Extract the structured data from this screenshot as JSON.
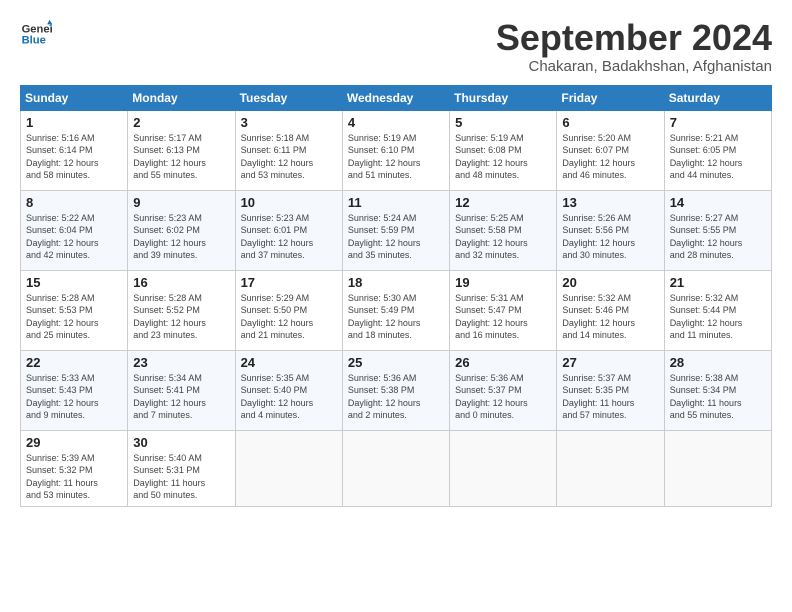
{
  "logo": {
    "line1": "General",
    "line2": "Blue"
  },
  "title": "September 2024",
  "subtitle": "Chakaran, Badakhshan, Afghanistan",
  "days_header": [
    "Sunday",
    "Monday",
    "Tuesday",
    "Wednesday",
    "Thursday",
    "Friday",
    "Saturday"
  ],
  "weeks": [
    [
      {
        "day": "1",
        "info": "Sunrise: 5:16 AM\nSunset: 6:14 PM\nDaylight: 12 hours\nand 58 minutes."
      },
      {
        "day": "2",
        "info": "Sunrise: 5:17 AM\nSunset: 6:13 PM\nDaylight: 12 hours\nand 55 minutes."
      },
      {
        "day": "3",
        "info": "Sunrise: 5:18 AM\nSunset: 6:11 PM\nDaylight: 12 hours\nand 53 minutes."
      },
      {
        "day": "4",
        "info": "Sunrise: 5:19 AM\nSunset: 6:10 PM\nDaylight: 12 hours\nand 51 minutes."
      },
      {
        "day": "5",
        "info": "Sunrise: 5:19 AM\nSunset: 6:08 PM\nDaylight: 12 hours\nand 48 minutes."
      },
      {
        "day": "6",
        "info": "Sunrise: 5:20 AM\nSunset: 6:07 PM\nDaylight: 12 hours\nand 46 minutes."
      },
      {
        "day": "7",
        "info": "Sunrise: 5:21 AM\nSunset: 6:05 PM\nDaylight: 12 hours\nand 44 minutes."
      }
    ],
    [
      {
        "day": "8",
        "info": "Sunrise: 5:22 AM\nSunset: 6:04 PM\nDaylight: 12 hours\nand 42 minutes."
      },
      {
        "day": "9",
        "info": "Sunrise: 5:23 AM\nSunset: 6:02 PM\nDaylight: 12 hours\nand 39 minutes."
      },
      {
        "day": "10",
        "info": "Sunrise: 5:23 AM\nSunset: 6:01 PM\nDaylight: 12 hours\nand 37 minutes."
      },
      {
        "day": "11",
        "info": "Sunrise: 5:24 AM\nSunset: 5:59 PM\nDaylight: 12 hours\nand 35 minutes."
      },
      {
        "day": "12",
        "info": "Sunrise: 5:25 AM\nSunset: 5:58 PM\nDaylight: 12 hours\nand 32 minutes."
      },
      {
        "day": "13",
        "info": "Sunrise: 5:26 AM\nSunset: 5:56 PM\nDaylight: 12 hours\nand 30 minutes."
      },
      {
        "day": "14",
        "info": "Sunrise: 5:27 AM\nSunset: 5:55 PM\nDaylight: 12 hours\nand 28 minutes."
      }
    ],
    [
      {
        "day": "15",
        "info": "Sunrise: 5:28 AM\nSunset: 5:53 PM\nDaylight: 12 hours\nand 25 minutes."
      },
      {
        "day": "16",
        "info": "Sunrise: 5:28 AM\nSunset: 5:52 PM\nDaylight: 12 hours\nand 23 minutes."
      },
      {
        "day": "17",
        "info": "Sunrise: 5:29 AM\nSunset: 5:50 PM\nDaylight: 12 hours\nand 21 minutes."
      },
      {
        "day": "18",
        "info": "Sunrise: 5:30 AM\nSunset: 5:49 PM\nDaylight: 12 hours\nand 18 minutes."
      },
      {
        "day": "19",
        "info": "Sunrise: 5:31 AM\nSunset: 5:47 PM\nDaylight: 12 hours\nand 16 minutes."
      },
      {
        "day": "20",
        "info": "Sunrise: 5:32 AM\nSunset: 5:46 PM\nDaylight: 12 hours\nand 14 minutes."
      },
      {
        "day": "21",
        "info": "Sunrise: 5:32 AM\nSunset: 5:44 PM\nDaylight: 12 hours\nand 11 minutes."
      }
    ],
    [
      {
        "day": "22",
        "info": "Sunrise: 5:33 AM\nSunset: 5:43 PM\nDaylight: 12 hours\nand 9 minutes."
      },
      {
        "day": "23",
        "info": "Sunrise: 5:34 AM\nSunset: 5:41 PM\nDaylight: 12 hours\nand 7 minutes."
      },
      {
        "day": "24",
        "info": "Sunrise: 5:35 AM\nSunset: 5:40 PM\nDaylight: 12 hours\nand 4 minutes."
      },
      {
        "day": "25",
        "info": "Sunrise: 5:36 AM\nSunset: 5:38 PM\nDaylight: 12 hours\nand 2 minutes."
      },
      {
        "day": "26",
        "info": "Sunrise: 5:36 AM\nSunset: 5:37 PM\nDaylight: 12 hours\nand 0 minutes."
      },
      {
        "day": "27",
        "info": "Sunrise: 5:37 AM\nSunset: 5:35 PM\nDaylight: 11 hours\nand 57 minutes."
      },
      {
        "day": "28",
        "info": "Sunrise: 5:38 AM\nSunset: 5:34 PM\nDaylight: 11 hours\nand 55 minutes."
      }
    ],
    [
      {
        "day": "29",
        "info": "Sunrise: 5:39 AM\nSunset: 5:32 PM\nDaylight: 11 hours\nand 53 minutes."
      },
      {
        "day": "30",
        "info": "Sunrise: 5:40 AM\nSunset: 5:31 PM\nDaylight: 11 hours\nand 50 minutes."
      },
      {
        "day": "",
        "info": ""
      },
      {
        "day": "",
        "info": ""
      },
      {
        "day": "",
        "info": ""
      },
      {
        "day": "",
        "info": ""
      },
      {
        "day": "",
        "info": ""
      }
    ]
  ]
}
